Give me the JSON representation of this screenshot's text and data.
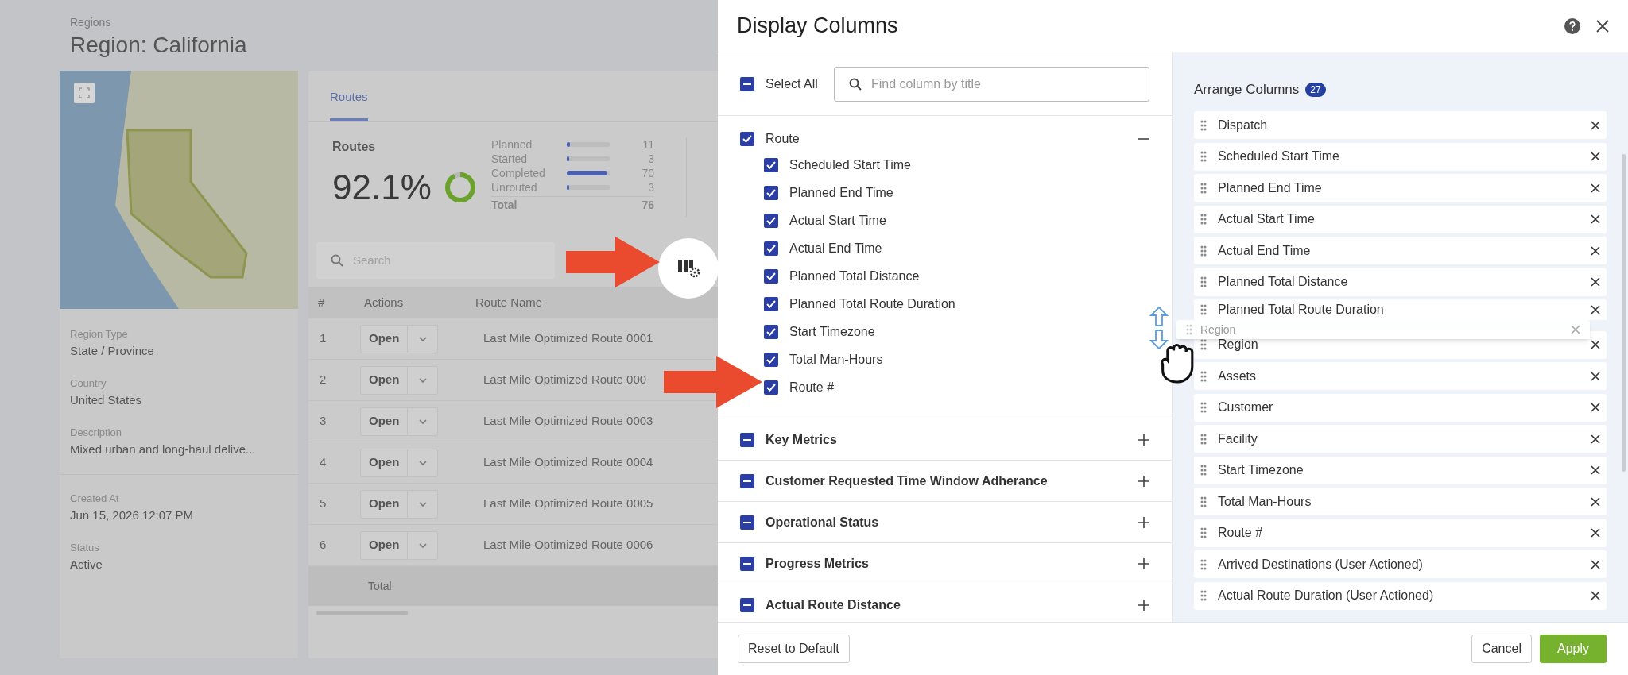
{
  "page": {
    "breadcrumb": "Regions",
    "title": "Region: California"
  },
  "region_details": [
    {
      "label": "Region Type",
      "value": "State / Province"
    },
    {
      "label": "Country",
      "value": "United States"
    },
    {
      "label": "Description",
      "value": "Mixed urban and long-haul delive..."
    },
    {
      "label": "Created At",
      "value": "Jun 15, 2026 12:07 PM"
    },
    {
      "label": "Status",
      "value": "Active"
    }
  ],
  "routes_card": {
    "tabs": [
      {
        "label": "Routes",
        "selected": true
      }
    ],
    "summary": {
      "title": "Routes",
      "percent": "92.1%",
      "level": 0.921
    },
    "legend": [
      {
        "label": "Planned",
        "count": "11",
        "level": 0.08
      },
      {
        "label": "Started",
        "count": "3",
        "level": 0.05
      },
      {
        "label": "Completed",
        "count": "70",
        "level": 0.92
      },
      {
        "label": "Unrouted",
        "count": "3",
        "level": 0.05
      }
    ],
    "total": {
      "label": "Total",
      "count": "76"
    },
    "search": {
      "placeholder": "Search"
    },
    "table": {
      "columns": [
        "#",
        "Actions",
        "Route Name"
      ],
      "rows": [
        {
          "number": "1",
          "action": "Open",
          "route_name": "Last Mile Optimized Route 0001"
        },
        {
          "number": "2",
          "action": "Open",
          "route_name": "Last Mile Optimized Route 000"
        },
        {
          "number": "3",
          "action": "Open",
          "route_name": "Last Mile Optimized Route 0003"
        },
        {
          "number": "4",
          "action": "Open",
          "route_name": "Last Mile Optimized Route 0004"
        },
        {
          "number": "5",
          "action": "Open",
          "route_name": "Last Mile Optimized Route 0005"
        },
        {
          "number": "6",
          "action": "Open",
          "route_name": "Last Mile Optimized Route 0006"
        }
      ],
      "footer": "Total"
    }
  },
  "dialog": {
    "title": "Display Columns",
    "select_all": {
      "label": "Select All",
      "checked": true,
      "indeterminate": true
    },
    "search": {
      "placeholder": "Find column by title"
    },
    "groups": [
      {
        "label": "Route",
        "checked": true,
        "indeterminate": false,
        "expanded": true,
        "children": [
          {
            "label": "Scheduled Start Time",
            "checked": true
          },
          {
            "label": "Planned End Time",
            "checked": true
          },
          {
            "label": "Actual Start Time",
            "checked": true
          },
          {
            "label": "Actual End Time",
            "checked": true
          },
          {
            "label": "Planned Total Distance",
            "checked": true
          },
          {
            "label": "Planned Total Route Duration",
            "checked": true
          },
          {
            "label": "Start Timezone",
            "checked": true
          },
          {
            "label": "Total Man-Hours",
            "checked": true
          },
          {
            "label": "Route #",
            "checked": true
          }
        ]
      },
      {
        "label": "Key Metrics",
        "checked": true,
        "indeterminate": true,
        "expanded": false
      },
      {
        "label": "Customer Requested Time Window Adherance",
        "checked": true,
        "indeterminate": true,
        "expanded": false
      },
      {
        "label": "Operational Status",
        "checked": true,
        "indeterminate": true,
        "expanded": false
      },
      {
        "label": "Progress Metrics",
        "checked": true,
        "indeterminate": true,
        "expanded": false
      },
      {
        "label": "Actual Route Distance",
        "checked": true,
        "indeterminate": true,
        "expanded": false
      }
    ],
    "arrange": {
      "title": "Arrange Columns",
      "count": "27",
      "items": [
        "Dispatch",
        "Scheduled Start Time",
        "Planned End Time",
        "Actual Start Time",
        "Actual End Time",
        "Planned Total Distance",
        "Planned Total Route Duration",
        "Region",
        "Assets",
        "Customer",
        "Facility",
        "Start Timezone",
        "Total Man-Hours",
        "Route #",
        "Arrived Destinations (User Actioned)",
        "Actual Route Duration (User Actioned)"
      ],
      "dragged_item": "Region"
    },
    "buttons": {
      "reset": "Reset to Default",
      "cancel": "Cancel",
      "apply": "Apply"
    }
  }
}
